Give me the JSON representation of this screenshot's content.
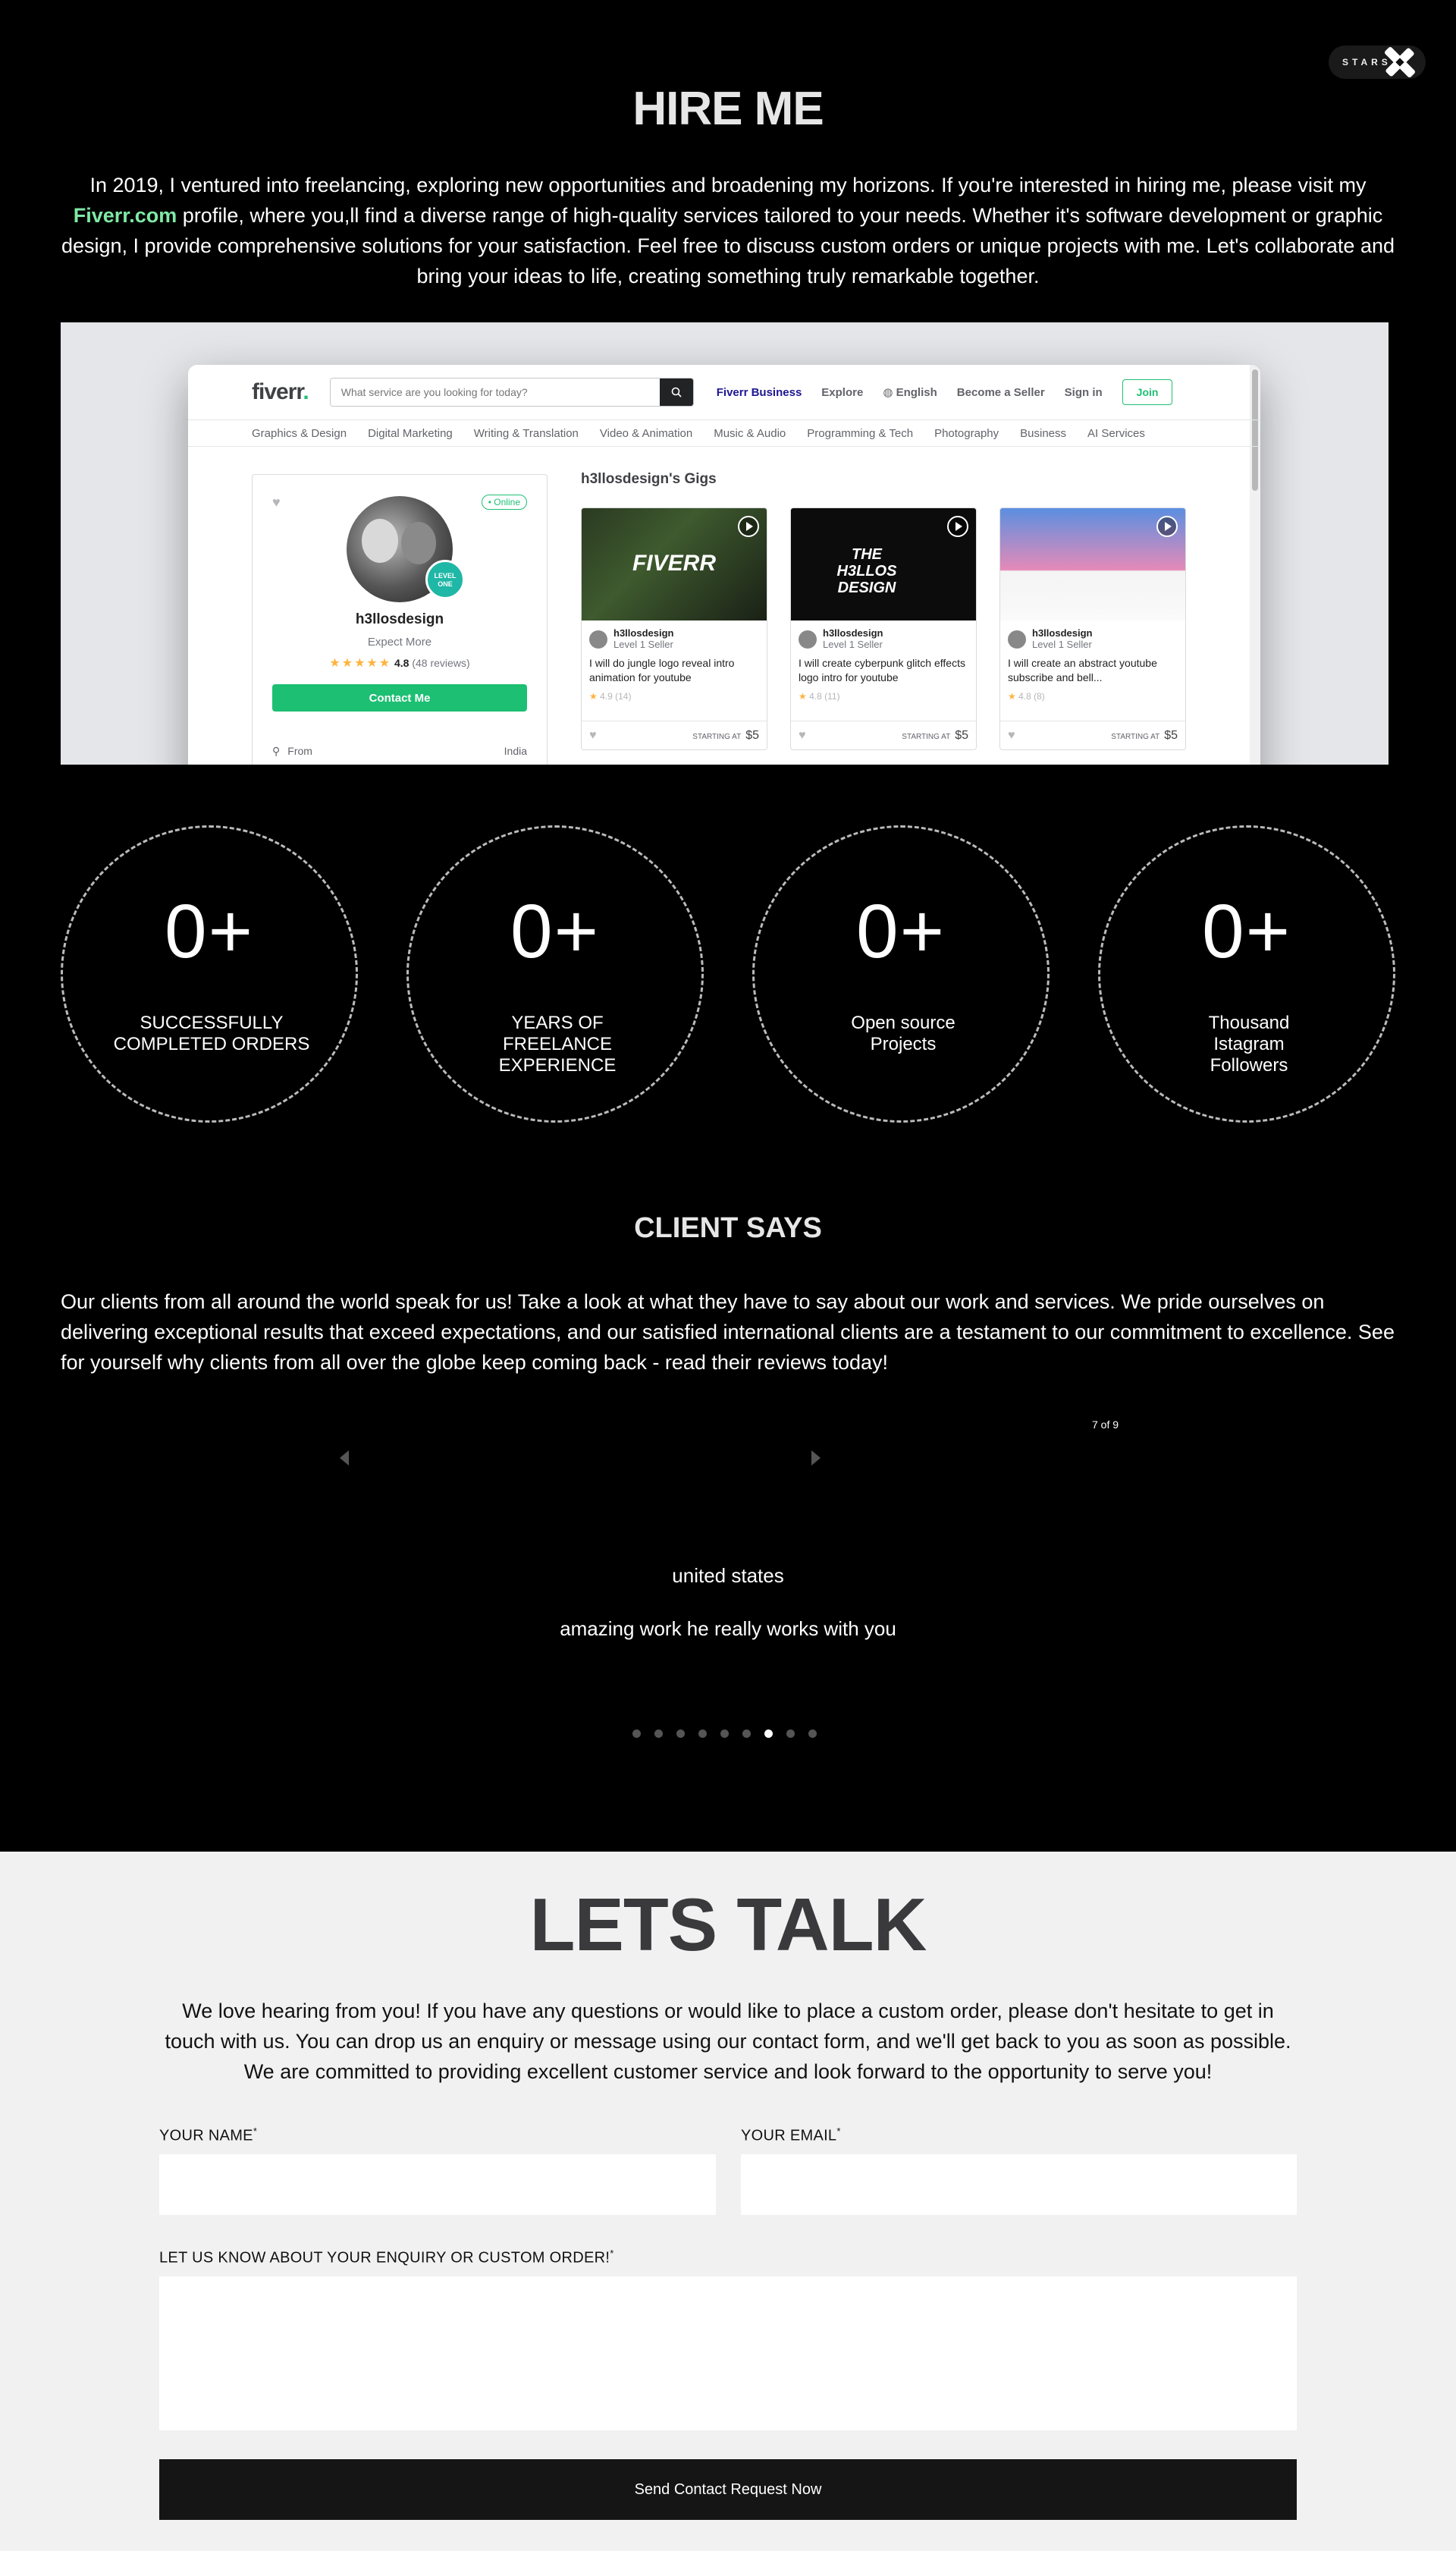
{
  "badge": {
    "label": "STARS"
  },
  "hire": {
    "title": "HIRE ME",
    "text_before": "In 2019, I ventured into freelancing, exploring new opportunities and broadening my horizons. If you're interested in hiring me, please visit my ",
    "link_text": "Fiverr.com",
    "text_after": " profile, where you,ll find a diverse range of high-quality services tailored to your needs. Whether it's software development or graphic design, I provide comprehensive solutions for your satisfaction. Feel free to discuss custom orders or unique projects with me. Let's collaborate and bring your ideas to life, creating something truly remarkable together."
  },
  "fiverr": {
    "logo": "fiverr",
    "logo_dot": ".",
    "search_placeholder": "What service are you looking for today?",
    "nav": [
      "Fiverr Business",
      "Explore",
      "English",
      "Become a Seller",
      "Sign in"
    ],
    "join": "Join",
    "categories": [
      "Graphics & Design",
      "Digital Marketing",
      "Writing & Translation",
      "Video & Animation",
      "Music & Audio",
      "Programming & Tech",
      "Photography",
      "Business",
      "AI Services"
    ],
    "profile": {
      "online": "• Online",
      "level_badge": "LEVEL ONE",
      "name": "h3llosdesign",
      "subtitle": "Expect More",
      "stars": "★★★★★",
      "rating": "4.8",
      "reviews": "(48 reviews)",
      "contact": "Contact Me",
      "from_label": "From",
      "from_value": "India"
    },
    "gigs_title": "h3llosdesign's Gigs",
    "gigs": [
      {
        "thumb_text": "FIVERR",
        "seller": "h3llosdesign",
        "level": "Level 1 Seller",
        "title": "I will do jungle logo reveal intro animation for youtube",
        "rating": "4.9",
        "count": "(14)",
        "starting": "STARTING AT",
        "price": "$5"
      },
      {
        "thumb_text": "THE H3LLOS DESIGN",
        "seller": "h3llosdesign",
        "level": "Level 1 Seller",
        "title": "I will create cyberpunk glitch effects logo intro for youtube",
        "rating": "4.8",
        "count": "(11)",
        "starting": "STARTING AT",
        "price": "$5"
      },
      {
        "thumb_text": "",
        "seller": "h3llosdesign",
        "level": "Level 1 Seller",
        "title": "I will create an abstract youtube subscribe and bell...",
        "rating": "4.8",
        "count": "(8)",
        "starting": "STARTING AT",
        "price": "$5"
      }
    ]
  },
  "stats": [
    {
      "value": "0+",
      "label": "SUCCESSFULLY COMPLETED ORDERS"
    },
    {
      "value": "0+",
      "label": "YEARS OF FREELANCE EXPERIENCE"
    },
    {
      "value": "0+",
      "label": "Open source Projects"
    },
    {
      "value": "0+",
      "label": "Thousand Istagram Followers"
    }
  ],
  "client": {
    "title": "CLIENT SAYS",
    "text": "Our clients from all around the world speak for us! Take a look at what they have to say about our work and services. We pride ourselves on delivering exceptional results that exceed expectations, and our satisfied international clients are a testament to our commitment to excellence. See for yourself why clients from all over the globe keep coming back - read their reviews today!",
    "counter": "7 of 9",
    "review_country": "united states",
    "review_text": "amazing work he really works with you",
    "total_slides": 9,
    "active_slide": 7
  },
  "talk": {
    "title": "LETS TALK",
    "text": "We love hearing from you! If you have any questions or would like to place a custom order, please don't hesitate to get in touch with us. You can drop us an enquiry or message using our contact form, and we'll get back to you as soon as possible. We are committed to providing excellent customer service and look forward to the opportunity to serve you!",
    "name_label": "YOUR NAME",
    "email_label": "YOUR EMAIL",
    "enquiry_label": "LET US KNOW ABOUT YOUR ENQUIRY OR CUSTOM ORDER!",
    "required_mark": "*",
    "submit": "Send Contact Request Now"
  }
}
